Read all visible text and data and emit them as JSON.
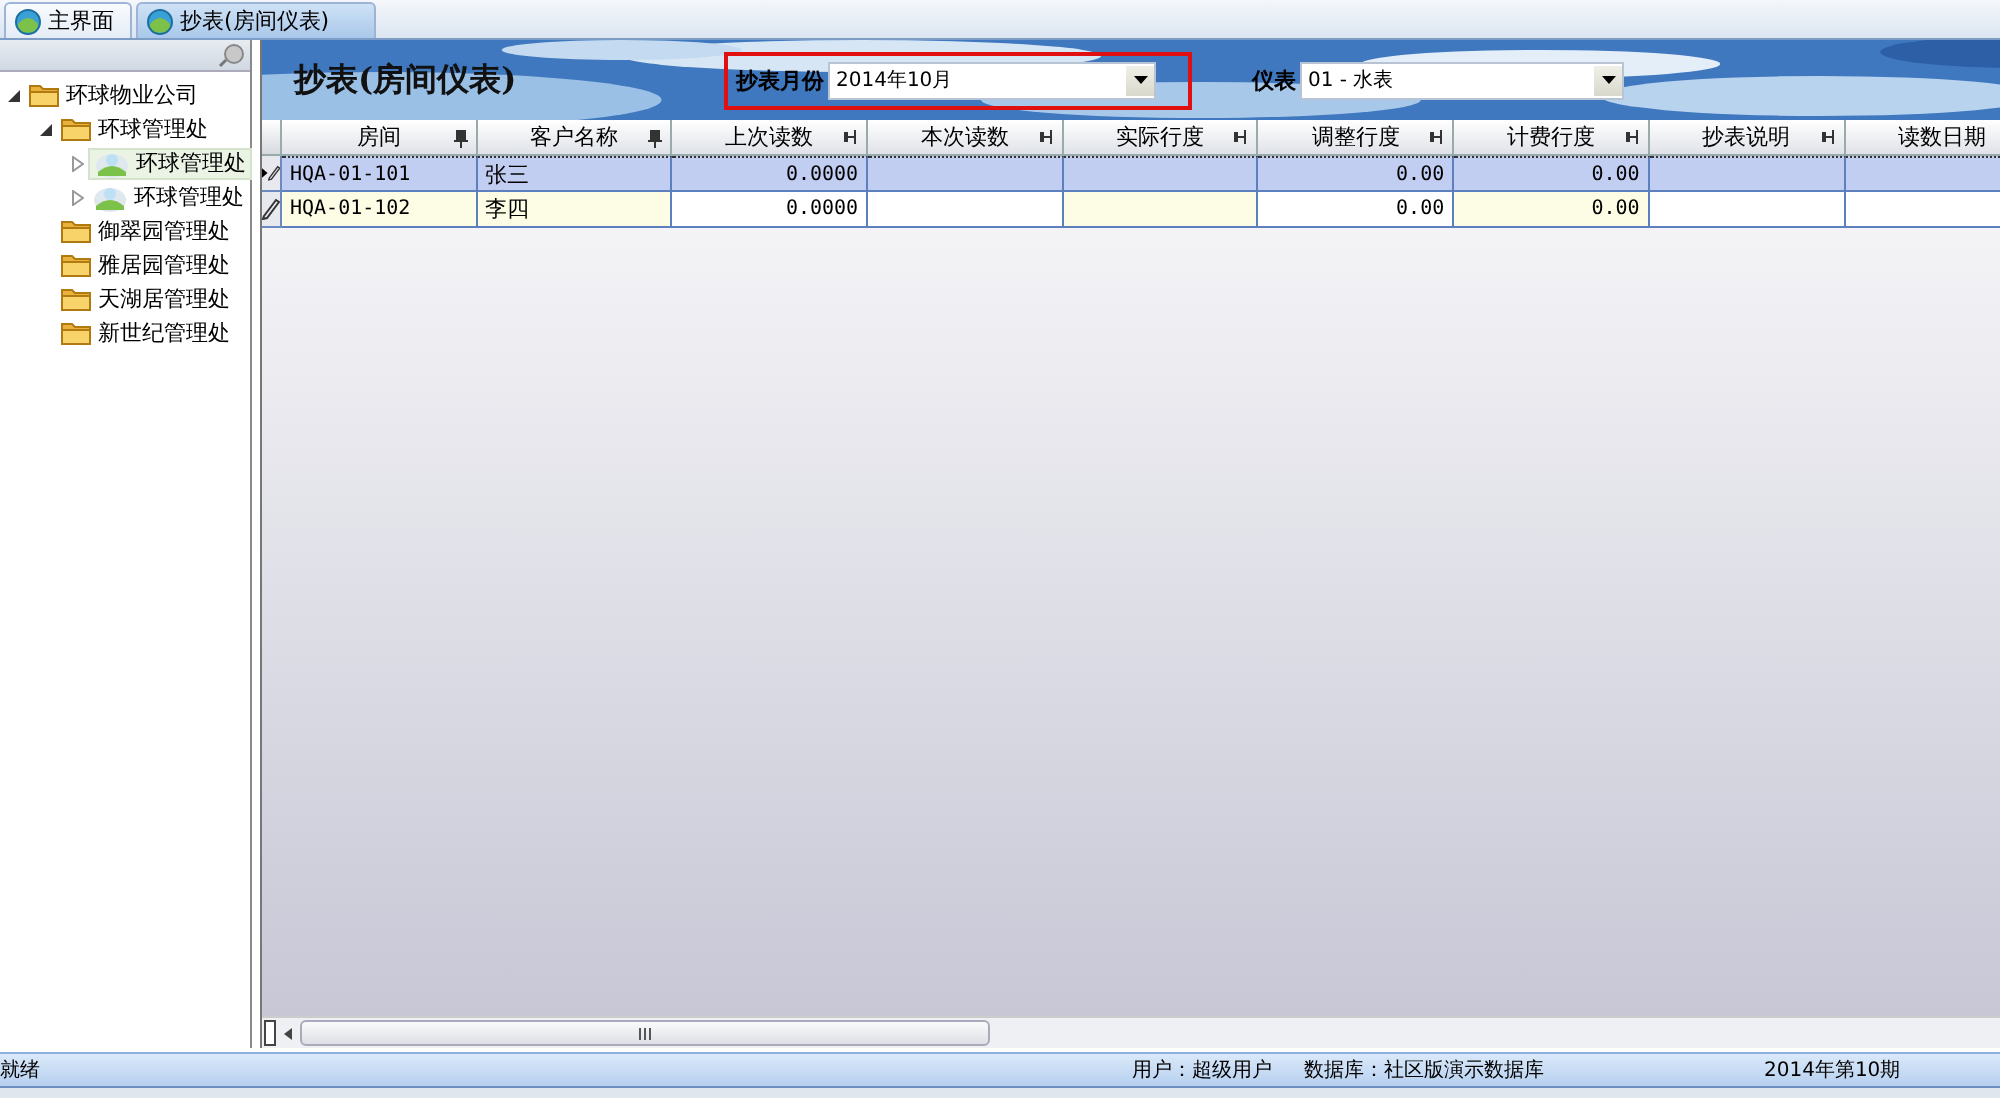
{
  "tabs": [
    {
      "label": "主界面",
      "selected": false
    },
    {
      "label": "抄表(房间仪表)",
      "selected": true
    }
  ],
  "tree": [
    {
      "label": "环球物业公司",
      "kind": "folder",
      "expanded": true,
      "selected": false,
      "children": [
        {
          "label": "环球管理处",
          "kind": "folder",
          "expanded": true,
          "selected": false,
          "children": [
            {
              "label": "环球管理处",
              "kind": "unit",
              "expanded": false,
              "selected": true
            },
            {
              "label": "环球管理处",
              "kind": "unit",
              "expanded": false,
              "selected": false
            }
          ]
        },
        {
          "label": "御翠园管理处",
          "kind": "folder",
          "selected": false
        },
        {
          "label": "雅居园管理处",
          "kind": "folder",
          "selected": false
        },
        {
          "label": "天湖居管理处",
          "kind": "folder",
          "selected": false
        },
        {
          "label": "新世纪管理处",
          "kind": "folder",
          "selected": false
        }
      ]
    }
  ],
  "page_title": "抄表(房间仪表)",
  "filters": [
    {
      "label": "抄表月份",
      "value": "2014年10月",
      "highlighted": true
    },
    {
      "label": "仪表",
      "value": "01 - 水表",
      "highlighted": false
    }
  ],
  "table": {
    "columns": [
      {
        "label": "房间",
        "pinned": true,
        "readonly": true
      },
      {
        "label": "客户名称",
        "pinned": true,
        "readonly": true
      },
      {
        "label": "上次读数",
        "pinned": false,
        "readonly": false,
        "numeric": true
      },
      {
        "label": "本次读数",
        "pinned": false,
        "readonly": false
      },
      {
        "label": "实际行度",
        "pinned": false,
        "readonly": true
      },
      {
        "label": "调整行度",
        "pinned": false,
        "readonly": false,
        "numeric": true
      },
      {
        "label": "计费行度",
        "pinned": false,
        "readonly": true,
        "numeric": true
      },
      {
        "label": "抄表说明",
        "pinned": false,
        "readonly": false
      },
      {
        "label": "读数日期",
        "readonly": false
      }
    ],
    "rows": [
      {
        "selected": true,
        "current": true,
        "cells": [
          "HQA-01-101",
          "张三",
          "0.0000",
          null,
          null,
          "0.00",
          "0.00",
          null,
          null
        ]
      },
      {
        "selected": false,
        "current": false,
        "cells": [
          "HQA-01-102",
          "李四",
          "0.0000",
          null,
          null,
          "0.00",
          "0.00",
          null,
          null
        ]
      }
    ]
  },
  "status_bar": {
    "state": "就绪",
    "user": "用户：超级用户",
    "database": "数据库：社区版演示数据库",
    "period": "2014年第10期"
  }
}
